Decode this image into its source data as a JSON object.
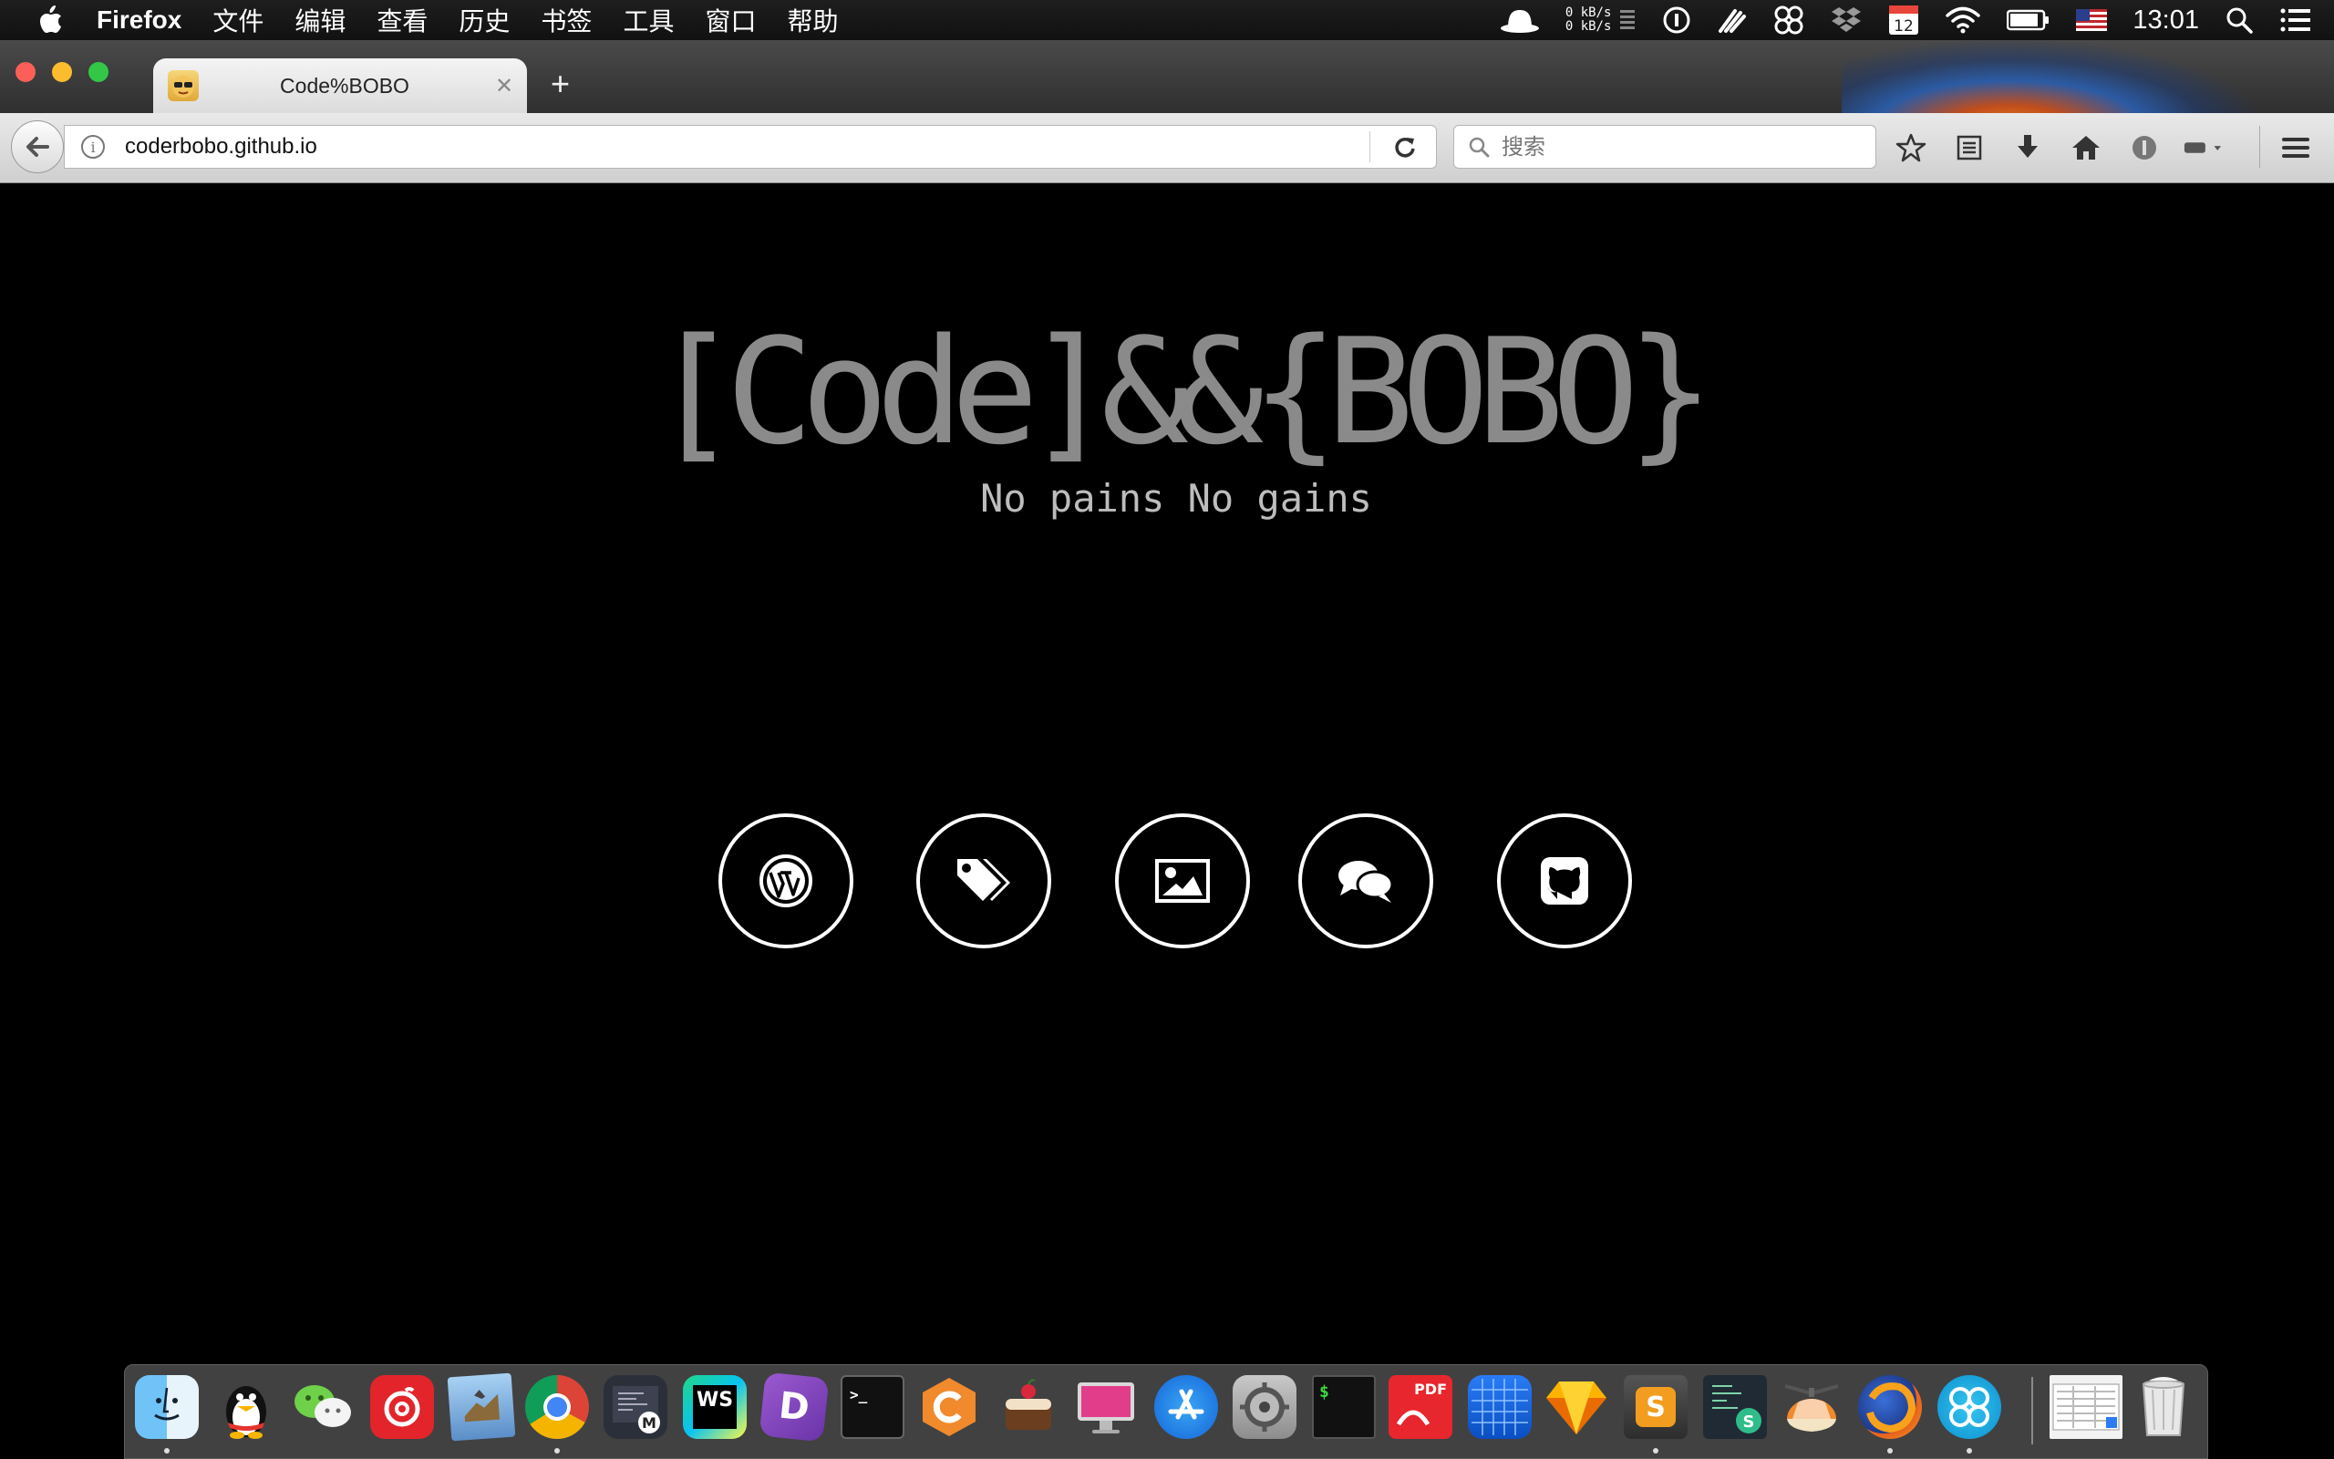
{
  "menubar": {
    "apple_icon": "apple-icon",
    "items": [
      "Firefox",
      "文件",
      "编辑",
      "查看",
      "历史",
      "书签",
      "工具",
      "窗口",
      "帮助"
    ],
    "status": {
      "net_up": "0 kB/s",
      "net_down": "0 kB/s",
      "calendar_day": "12",
      "clock": "13:01",
      "icons": [
        "hat-icon",
        "network-monitor-icon",
        "1password-icon",
        "paw-icon",
        "xmind-icon",
        "dropbox-icon",
        "calendar-icon",
        "wifi-icon",
        "battery-icon",
        "us-flag-icon",
        "spotlight-icon",
        "notification-center-icon"
      ]
    }
  },
  "browser": {
    "tab_title": "Code%BOBO",
    "new_tab_label": "+",
    "tab_close_label": "✕",
    "url": "coderbobo.github.io",
    "search_placeholder": "搜索"
  },
  "page": {
    "title": "[Code]&&{BOBO}",
    "subtitle": "No pains No gains",
    "social_links": [
      {
        "name": "wordpress-icon"
      },
      {
        "name": "tags-icon"
      },
      {
        "name": "image-icon"
      },
      {
        "name": "comments-icon"
      },
      {
        "name": "github-icon"
      }
    ]
  },
  "dock": {
    "apps": [
      "finder",
      "qq",
      "wechat",
      "netease-music",
      "preview",
      "chrome",
      "mweb",
      "webstorm",
      "dash",
      "terminal",
      "coderunner",
      "cake-brew",
      "imac-app",
      "app-store",
      "system-preferences",
      "iterm",
      "pdf-expert",
      "grid-app",
      "sketch",
      "sublime-text",
      "scrivener-script",
      "propeller-app",
      "firefox",
      "xmind",
      "downloads-stack",
      "trash"
    ],
    "downloads_label": "",
    "iterm_label": "$",
    "pdf_label": "PDF",
    "sublime_label": "S",
    "webstorm_label": "WS",
    "dash_label": "D",
    "terminal_label": ">_"
  },
  "colors": {
    "page_background": "#000000",
    "title_color": "#8a8a8a",
    "subtitle_color": "#bdbdbd",
    "social_border": "#ffffff"
  }
}
